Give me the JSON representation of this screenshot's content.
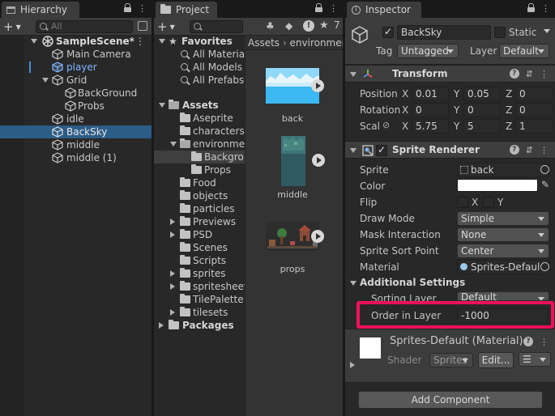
{
  "hierarchy": {
    "tab": "Hierarchy",
    "search_placeholder": "All",
    "scene": "SampleScene*",
    "items": [
      {
        "label": "Main Camera"
      },
      {
        "label": "player"
      },
      {
        "label": "Grid"
      },
      {
        "label": "BackGround"
      },
      {
        "label": "Probs"
      },
      {
        "label": "idle"
      },
      {
        "label": "BackSky"
      },
      {
        "label": "middle"
      },
      {
        "label": "middle (1)"
      }
    ]
  },
  "project": {
    "tab": "Project",
    "favorites": {
      "label": "Favorites",
      "items": [
        "All Material",
        "All Models",
        "All Prefabs"
      ]
    },
    "assets": {
      "label": "Assets",
      "folders": [
        "Aseprite",
        "characters",
        "environmen",
        "Backgro",
        "Props",
        "Food",
        "objects",
        "particles",
        "Previews",
        "PSD",
        "Scenes",
        "Scripts",
        "sprites",
        "spritesheet",
        "TilePalette",
        "tilesets"
      ]
    },
    "packages": "Packages",
    "breadcrumb": [
      "Assets",
      "environmen"
    ],
    "badge": "7",
    "thumbnails": [
      {
        "label": "back"
      },
      {
        "label": "middle"
      },
      {
        "label": "props"
      }
    ]
  },
  "inspector": {
    "tab": "Inspector",
    "object_name": "BackSky",
    "static_label": "Static",
    "tag_label": "Tag",
    "tag_value": "Untagged",
    "layer_label": "Layer",
    "layer_value": "Default",
    "transform": {
      "title": "Transform",
      "rows": [
        {
          "label": "Position",
          "x": "0.01",
          "y": "0.05",
          "z": "0"
        },
        {
          "label": "Rotation",
          "x": "0",
          "y": "0",
          "z": "0"
        },
        {
          "label": "Scal",
          "x": "5.75",
          "y": "5",
          "z": "1"
        }
      ]
    },
    "sprite_renderer": {
      "title": "Sprite Renderer",
      "sprite_label": "Sprite",
      "sprite_value": "back",
      "color_label": "Color",
      "flip_label": "Flip",
      "flip_x": "X",
      "flip_y": "Y",
      "draw_mode_label": "Draw Mode",
      "draw_mode_value": "Simple",
      "mask_label": "Mask Interaction",
      "mask_value": "None",
      "sort_point_label": "Sprite Sort Point",
      "sort_point_value": "Center",
      "material_label": "Material",
      "material_value": "Sprites-Defaul",
      "additional_label": "Additional Settings",
      "sorting_layer_label": "Sorting Layer",
      "sorting_layer_value": "Default",
      "order_label": "Order in Layer",
      "order_value": "-1000"
    },
    "material": {
      "title": "Sprites-Default (Material)",
      "shader_label": "Shader",
      "shader_value": "Sprites",
      "edit_label": "Edit..."
    },
    "add_component": "Add Component"
  },
  "colors": {
    "selection": "#2c5d87",
    "highlight": "#f0105a",
    "player_text": "#7fb5ff"
  }
}
